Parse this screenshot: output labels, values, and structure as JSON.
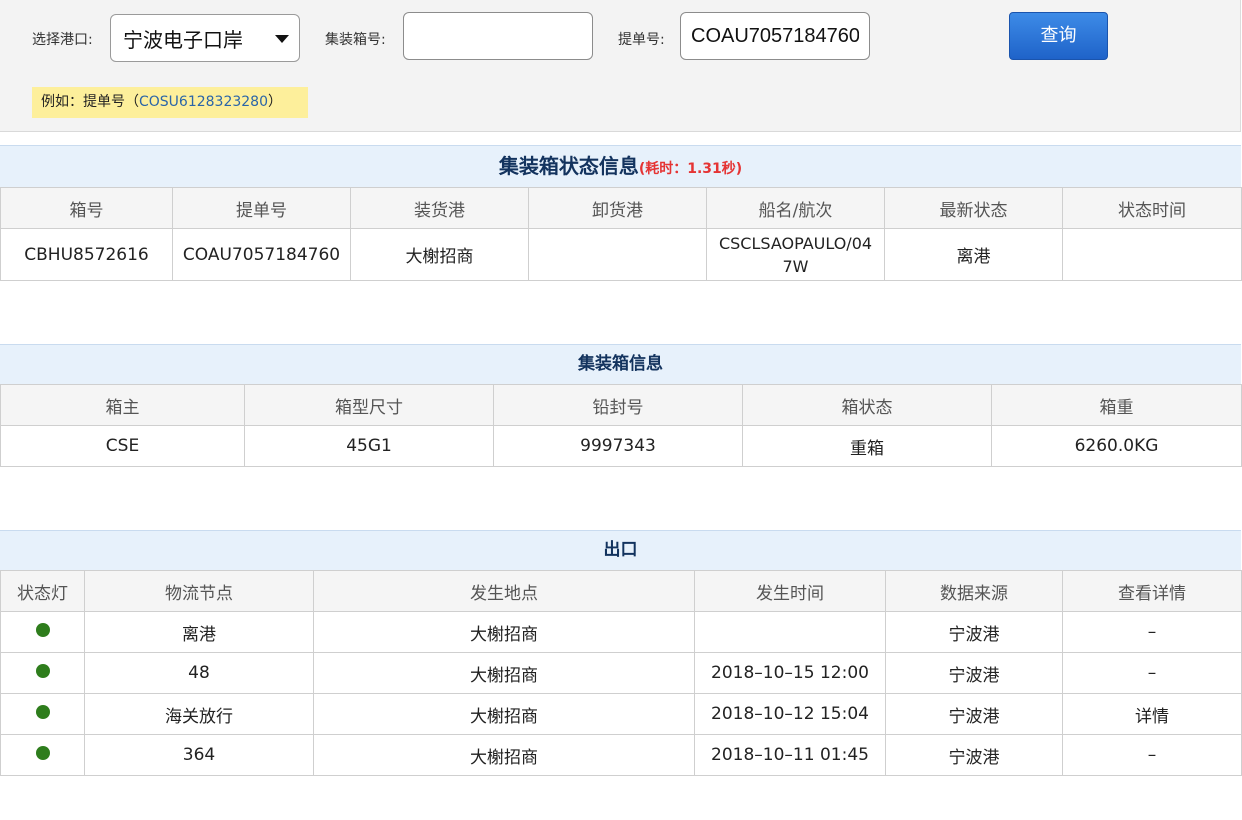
{
  "search": {
    "port_label": "选择港口:",
    "port_value": "宁波电子口岸",
    "container_label": "集装箱号:",
    "container_value": "",
    "bl_label": "提单号:",
    "bl_value": "COAU7057184760",
    "query_label": "查询",
    "hint_prefix": "例如：提单号（",
    "hint_example": "COSU6128323280",
    "hint_suffix": "）"
  },
  "status_section": {
    "title": "集装箱状态信息",
    "elapsed": "(耗时：1.31秒)",
    "columns": [
      "箱号",
      "提单号",
      "装货港",
      "卸货港",
      "船名/航次",
      "最新状态",
      "状态时间"
    ],
    "row": {
      "container_no": "CBHU8572616",
      "bl_no": "COAU7057184760",
      "load_port": "大榭招商",
      "discharge_port": "",
      "vessel_line1": "CSCLSAOPAULO/04",
      "vessel_line2": "7W",
      "latest_status": "离港",
      "status_time": ""
    }
  },
  "container_section": {
    "title": "集装箱信息",
    "columns": [
      "箱主",
      "箱型尺寸",
      "铅封号",
      "箱状态",
      "箱重"
    ],
    "row": {
      "owner": "CSE",
      "type_size": "45G1",
      "seal_no": "9997343",
      "box_status": "重箱",
      "weight": "6260.0KG"
    }
  },
  "export_section": {
    "title": "出口",
    "columns": [
      "状态灯",
      "物流节点",
      "发生地点",
      "发生时间",
      "数据来源",
      "查看详情"
    ],
    "status_light_color": "#2e7d1c",
    "rows": [
      {
        "node": "离港",
        "location": "大榭招商",
        "time": "",
        "source": "宁波港",
        "detail": "–"
      },
      {
        "node": "48",
        "location": "大榭招商",
        "time": "2018–10–15 12:00",
        "source": "宁波港",
        "detail": "–"
      },
      {
        "node": "海关放行",
        "location": "大榭招商",
        "time": "2018–10–12 15:04",
        "source": "宁波港",
        "detail": "详情"
      },
      {
        "node": "364",
        "location": "大榭招商",
        "time": "2018–10–11 01:45",
        "source": "宁波港",
        "detail": "–"
      }
    ]
  }
}
